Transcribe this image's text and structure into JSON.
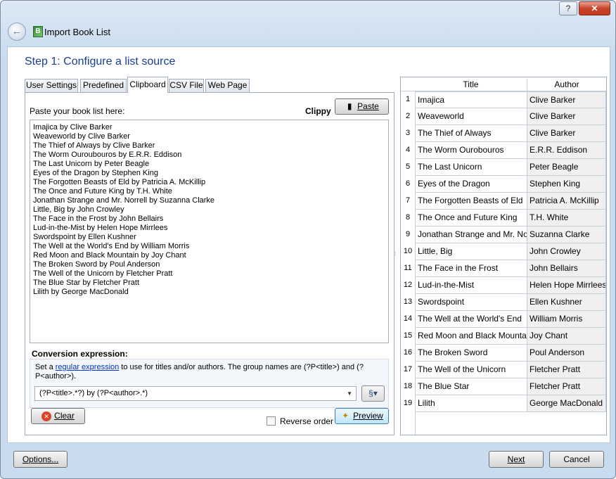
{
  "window": {
    "help_label": "?",
    "close_label": "✕",
    "title": "Import Book List"
  },
  "step_title": "Step 1: Configure a list source",
  "tabs": [
    {
      "label": "User Settings"
    },
    {
      "label": "Predefined"
    },
    {
      "label": "Clipboard"
    },
    {
      "label": "CSV File"
    },
    {
      "label": "Web Page"
    }
  ],
  "clipboard": {
    "paste_label": "Paste your book list here:",
    "clippy_label": "Clippy",
    "paste_button": "Paste",
    "lines": [
      "Imajica by Clive Barker",
      "Weaveworld by Clive Barker",
      "The Thief of Always by Clive Barker",
      "The Worm Ouroubouros by E.R.R. Eddison",
      "The Last Unicorn by Peter Beagle",
      "Eyes of the Dragon by Stephen King",
      "The Forgotten Beasts of Eld by Patricia A. McKillip",
      "The Once and Future King by T.H. White",
      "Jonathan Strange and Mr. Norrell by Suzanna Clarke",
      "Little, Big by John Crowley",
      "The Face in the Frost by John Bellairs",
      "Lud-in-the-Mist by Helen Hope Mirrlees",
      "Swordspoint by Ellen Kushner",
      "The Well at the World's End by William Morris",
      "Red Moon and Black Mountain by Joy Chant",
      "The Broken Sword by Poul Anderson",
      "The Well of the Unicorn by Fletcher Pratt",
      "The Blue Star by Fletcher Pratt",
      "Lilith by George MacDonald"
    ],
    "conversion_heading": "Conversion expression:",
    "desc_prefix": "Set a ",
    "desc_link": "regular expression",
    "desc_suffix": " to use for titles and/or authors. The group names are (?P<title>) and (?P<author>).",
    "expression": "(?P<title>.*?) by (?P<author>.*)",
    "clear_button": "Clear",
    "reverse_label": "Reverse order",
    "preview_button": "Preview"
  },
  "grid": {
    "col_title": "Title",
    "col_author": "Author",
    "rows": [
      {
        "num": "1",
        "title": "Imajica",
        "author": "Clive Barker"
      },
      {
        "num": "2",
        "title": "Weaveworld",
        "author": "Clive Barker"
      },
      {
        "num": "3",
        "title": "The Thief of Always",
        "author": "Clive Barker"
      },
      {
        "num": "4",
        "title": "The Worm Ourobouros",
        "author": "E.R.R. Eddison"
      },
      {
        "num": "5",
        "title": "The Last Unicorn",
        "author": "Peter Beagle"
      },
      {
        "num": "6",
        "title": "Eyes of the Dragon",
        "author": "Stephen King"
      },
      {
        "num": "7",
        "title": "The Forgotten Beasts of Eld",
        "author": "Patricia A. McKillip"
      },
      {
        "num": "8",
        "title": "The Once and Future King",
        "author": "T.H. White"
      },
      {
        "num": "9",
        "title": "Jonathan Strange and Mr. No...",
        "author": "Suzanna Clarke"
      },
      {
        "num": "10",
        "title": "Little, Big",
        "author": "John Crowley"
      },
      {
        "num": "11",
        "title": "The Face in the Frost",
        "author": "John Bellairs"
      },
      {
        "num": "12",
        "title": "Lud-in-the-Mist",
        "author": "Helen Hope Mirrlees"
      },
      {
        "num": "13",
        "title": "Swordspoint",
        "author": "Ellen Kushner"
      },
      {
        "num": "14",
        "title": "The Well at the World's End",
        "author": "William Morris"
      },
      {
        "num": "15",
        "title": "Red Moon and Black Mountain",
        "author": "Joy Chant"
      },
      {
        "num": "16",
        "title": "The Broken Sword",
        "author": "Poul Anderson"
      },
      {
        "num": "17",
        "title": "The Well of the Unicorn",
        "author": "Fletcher Pratt"
      },
      {
        "num": "18",
        "title": "The Blue Star",
        "author": "Fletcher Pratt"
      },
      {
        "num": "19",
        "title": "Lilith",
        "author": "George MacDonald"
      }
    ]
  },
  "footer": {
    "options_button": "Options...",
    "next_button": "Next",
    "cancel_button": "Cancel"
  }
}
